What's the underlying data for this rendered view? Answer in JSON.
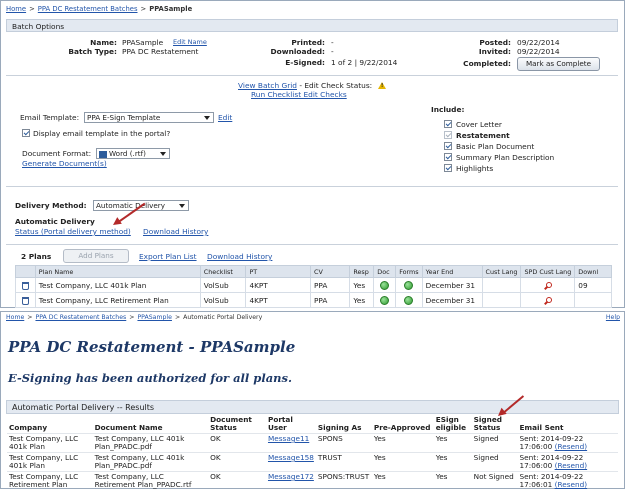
{
  "top": {
    "breadcrumb": [
      "Home",
      "PPA DC Restatement Batches",
      "PPASample"
    ],
    "section_title": "Batch Options",
    "info": {
      "name_label": "Name:",
      "name_value": "PPASample",
      "edit_name": "Edit Name",
      "batch_type_label": "Batch Type:",
      "batch_type_value": "PPA DC Restatement",
      "printed_label": "Printed:",
      "printed_value": "-",
      "downloaded_label": "Downloaded:",
      "downloaded_value": "-",
      "esigned_label": "E-Signed:",
      "esigned_value": "1 of 2 | 9/22/2014",
      "posted_label": "Posted:",
      "posted_value": "09/22/2014",
      "invited_label": "Invited:",
      "invited_value": "09/22/2014",
      "completed_label": "Completed:",
      "mark_complete": "Mark as Complete"
    },
    "links": {
      "view_batch_grid": "View Batch Grid",
      "edit_check_status": "- Edit Check Status:",
      "run_checklist": "Run Checklist Edit Checks"
    },
    "email": {
      "template_label": "Email Template:",
      "template_value": "PPA E-Sign Template",
      "edit": "Edit",
      "display_label": "Display email template in the portal?",
      "format_label": "Document Format:",
      "format_value": "Word (.rtf)",
      "generate": "Generate Document(s)"
    },
    "include": {
      "label": "Include:",
      "items": [
        {
          "label": "Cover Letter",
          "checked": true,
          "bold": false
        },
        {
          "label": "Restatement",
          "checked": true,
          "bold": true
        },
        {
          "label": "Basic Plan Document",
          "checked": true,
          "bold": false
        },
        {
          "label": "Summary Plan Description",
          "checked": true,
          "bold": false
        },
        {
          "label": "Highlights",
          "checked": true,
          "bold": false
        }
      ]
    },
    "delivery": {
      "method_label": "Delivery Method:",
      "method_value": "Automatic Delivery",
      "auto_title": "Automatic Delivery",
      "status_link": "Status (Portal delivery method)",
      "download_history": "Download History"
    },
    "plans": {
      "count_label": "2 Plans",
      "add_plans": "Add Plans",
      "export_plan_list": "Export Plan List",
      "download_history": "Download History",
      "columns": [
        "",
        "Plan Name",
        "Checklist",
        "PT",
        "CV",
        "Resp",
        "Doc",
        "Forms",
        "Year End",
        "Cust Lang",
        "SPD Cust Lang",
        "Downl"
      ],
      "rows": [
        {
          "plan": "Test Company, LLC 401k Plan",
          "checklist": "VolSub",
          "pt": "4KPT",
          "cv": "PPA",
          "resp": "Yes",
          "year_end": "December 31",
          "cust_lang": "",
          "downl": "09"
        },
        {
          "plan": "Test Company, LLC Retirement Plan",
          "checklist": "VolSub",
          "pt": "4KPT",
          "cv": "PPA",
          "resp": "Yes",
          "year_end": "December 31",
          "cust_lang": "",
          "downl": ""
        }
      ]
    }
  },
  "bottom": {
    "breadcrumb": [
      "Home",
      "PPA DC Restatement Batches",
      "PPASample",
      "Automatic Portal Delivery"
    ],
    "help": "Help",
    "title": "PPA DC Restatement - PPASample",
    "subtitle": "E-Signing has been authorized for all plans.",
    "results_title": "Automatic Portal Delivery -- Results",
    "columns": [
      "Company",
      "Document Name",
      "Document Status",
      "Portal User",
      "Signing As",
      "Pre-Approved",
      "ESign eligible",
      "Signed Status",
      "Email Sent"
    ],
    "rows": [
      {
        "company": "Test Company, LLC 401k Plan",
        "doc": "Test Company, LLC 401k Plan_PPADC.pdf",
        "status": "OK",
        "user": "Message11",
        "signing_as": "SPONS",
        "pre": "Yes",
        "eligible": "Yes",
        "signed": "Signed",
        "sent": "Sent: 2014-09-22 17:06:00",
        "resend": "(Resend)"
      },
      {
        "company": "Test Company, LLC 401k Plan",
        "doc": "Test Company, LLC 401k Plan_PPADC.pdf",
        "status": "OK",
        "user": "Message158",
        "signing_as": "TRUST",
        "pre": "Yes",
        "eligible": "Yes",
        "signed": "Signed",
        "sent": "Sent: 2014-09-22 17:06:00",
        "resend": "(Resend)"
      },
      {
        "company": "Test Company, LLC Retirement Plan",
        "doc": "Test Company, LLC Retirement Plan_PPADC.rtf",
        "status": "OK",
        "user": "Message172",
        "signing_as": "SPONS:TRUST",
        "pre": "Yes",
        "eligible": "Yes",
        "signed": "Not Signed",
        "sent": "Sent: 2014-09-22 17:06:01",
        "resend": "(Resend)"
      }
    ]
  },
  "colors": {
    "title": "#1d3866",
    "link": "#2255aa",
    "arrow": "#b32a2a",
    "header_bg": "#e3e9f1"
  }
}
